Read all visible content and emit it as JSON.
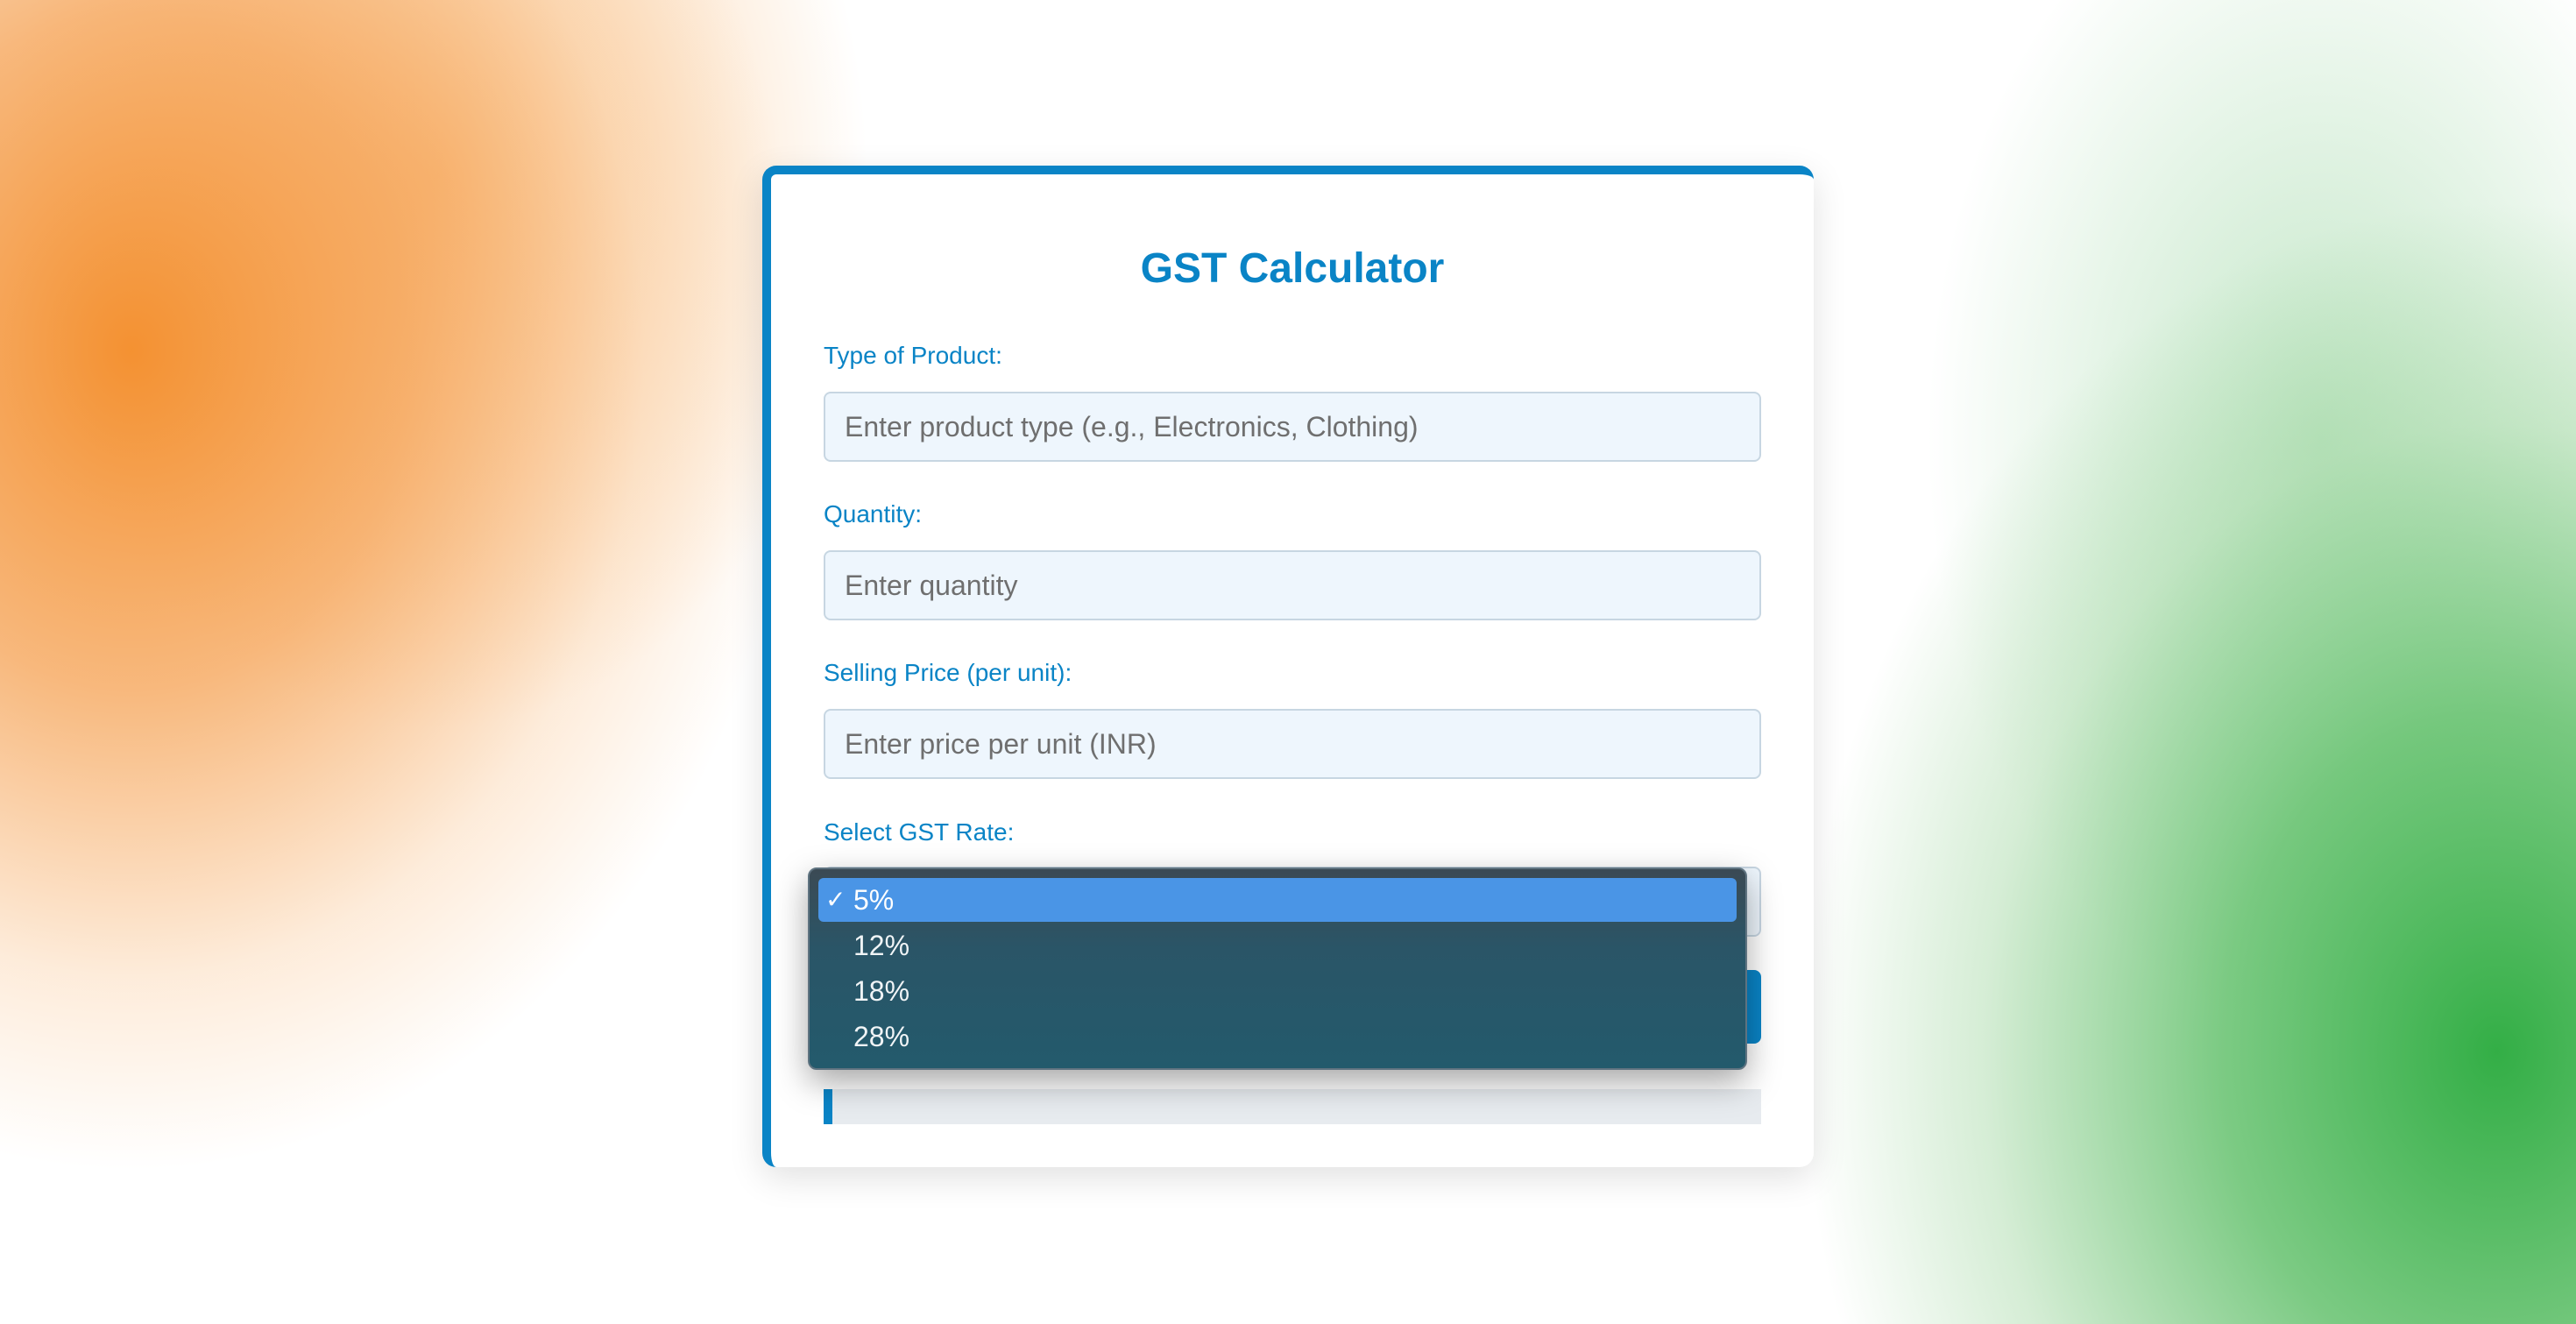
{
  "title": "GST Calculator",
  "fields": {
    "product_type": {
      "label": "Type of Product:",
      "placeholder": "Enter product type (e.g., Electronics, Clothing)"
    },
    "quantity": {
      "label": "Quantity:",
      "placeholder": "Enter quantity"
    },
    "selling_price": {
      "label": "Selling Price (per unit):",
      "placeholder": "Enter price per unit (INR)"
    },
    "gst_rate": {
      "label": "Select GST Rate:",
      "selected": "5%",
      "options": [
        "5%",
        "12%",
        "18%",
        "28%"
      ]
    }
  },
  "icons": {
    "check": "checkmark-icon",
    "chevron": "chevron-down-icon"
  },
  "colors": {
    "accent": "#0a84c6",
    "dropdown_highlight": "#4a95e6",
    "input_bg": "#eef6fd"
  }
}
